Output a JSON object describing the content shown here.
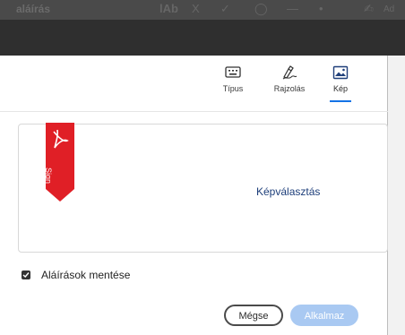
{
  "app_bar": {
    "title": "aláírás",
    "toolbar_glyphs": [
      "lAb",
      "X",
      "✓",
      "◯",
      "—",
      "•",
      "✍",
      "Ad"
    ]
  },
  "tabs": [
    {
      "label": "Típus",
      "icon": "keyboard-icon",
      "active": false
    },
    {
      "label": "Rajzolás",
      "icon": "pen-draw-icon",
      "active": false
    },
    {
      "label": "Kép",
      "icon": "image-icon",
      "active": true
    }
  ],
  "canvas": {
    "ribbon_text": "Sign",
    "ribbon_color": "#e01f26",
    "pick_image_label": "Képválasztás"
  },
  "save_signatures": {
    "label": "Aláírások mentése",
    "checked": true
  },
  "buttons": {
    "cancel": "Mégse",
    "apply": "Alkalmaz",
    "accent": "#1473e6"
  }
}
